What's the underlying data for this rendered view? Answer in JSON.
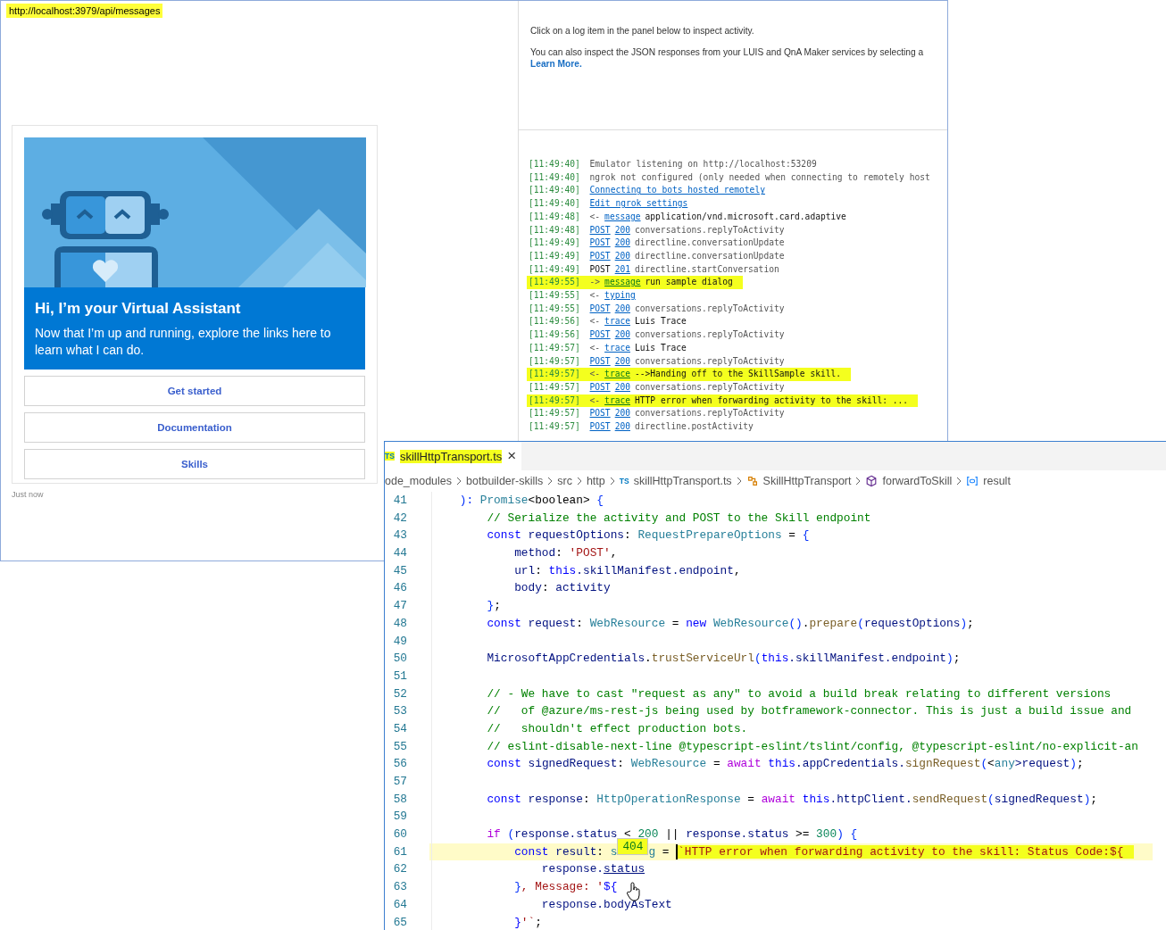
{
  "emulator": {
    "endpoint": "http://localhost:3979/api/messages",
    "card": {
      "heading": "Hi, I’m **your Virtual Assistant**",
      "body": "Now that I’m up and running, explore the links here to learn what I can do.",
      "buttons": [
        "Get started",
        "Documentation",
        "Skills"
      ]
    },
    "timestamp": "Just now",
    "inspector": {
      "hint": "Click on a log item in the panel below to inspect activity.",
      "info": "You can also inspect the JSON responses from your LUIS and QnA Maker services by selecting a",
      "link": "Learn More."
    },
    "log": [
      {
        "time": "[11:49:40]",
        "highlighted": false,
        "segments": [
          {
            "kind": "muted",
            "text": "Emulator listening on http://localhost:53209"
          }
        ]
      },
      {
        "time": "[11:49:40]",
        "highlighted": false,
        "segments": [
          {
            "kind": "muted",
            "text": "ngrok not configured (only needed when connecting to remotely host"
          }
        ]
      },
      {
        "time": "[11:49:40]",
        "highlighted": false,
        "segments": [
          {
            "kind": "link",
            "text": "Connecting to bots hosted remotely"
          }
        ]
      },
      {
        "time": "[11:49:40]",
        "highlighted": false,
        "segments": [
          {
            "kind": "link",
            "text": "Edit ngrok settings"
          }
        ]
      },
      {
        "time": "[11:49:48]",
        "highlighted": false,
        "segments": [
          {
            "kind": "muted",
            "text": "<-"
          },
          {
            "kind": "link",
            "text": "message"
          },
          {
            "kind": "text",
            "text": "application/vnd.microsoft.card.adaptive"
          }
        ]
      },
      {
        "time": "[11:49:48]",
        "highlighted": false,
        "segments": [
          {
            "kind": "link",
            "text": "POST"
          },
          {
            "kind": "link",
            "text": "200"
          },
          {
            "kind": "muted",
            "text": "conversations.replyToActivity"
          }
        ]
      },
      {
        "time": "[11:49:49]",
        "highlighted": false,
        "segments": [
          {
            "kind": "link",
            "text": "POST"
          },
          {
            "kind": "link",
            "text": "200"
          },
          {
            "kind": "muted",
            "text": "directline.conversationUpdate"
          }
        ]
      },
      {
        "time": "[11:49:49]",
        "highlighted": false,
        "segments": [
          {
            "kind": "link",
            "text": "POST"
          },
          {
            "kind": "link",
            "text": "200"
          },
          {
            "kind": "muted",
            "text": "directline.conversationUpdate"
          }
        ]
      },
      {
        "time": "[11:49:49]",
        "highlighted": false,
        "segments": [
          {
            "kind": "text",
            "text": "POST"
          },
          {
            "kind": "link",
            "text": "201"
          },
          {
            "kind": "muted",
            "text": "directline.startConversation"
          }
        ]
      },
      {
        "time": "[11:49:55]",
        "highlighted": true,
        "segments": [
          {
            "kind": "muted",
            "text": "->"
          },
          {
            "kind": "link",
            "text": "message"
          },
          {
            "kind": "text",
            "text": "run sample dialog"
          }
        ]
      },
      {
        "time": "[11:49:55]",
        "highlighted": false,
        "segments": [
          {
            "kind": "muted",
            "text": "<-"
          },
          {
            "kind": "link",
            "text": "typing"
          }
        ]
      },
      {
        "time": "[11:49:55]",
        "highlighted": false,
        "segments": [
          {
            "kind": "link",
            "text": "POST"
          },
          {
            "kind": "link",
            "text": "200"
          },
          {
            "kind": "muted",
            "text": "conversations.replyToActivity"
          }
        ]
      },
      {
        "time": "[11:49:56]",
        "highlighted": false,
        "segments": [
          {
            "kind": "muted",
            "text": "<-"
          },
          {
            "kind": "link",
            "text": "trace"
          },
          {
            "kind": "text",
            "text": "Luis Trace"
          }
        ]
      },
      {
        "time": "[11:49:56]",
        "highlighted": false,
        "segments": [
          {
            "kind": "link",
            "text": "POST"
          },
          {
            "kind": "link",
            "text": "200"
          },
          {
            "kind": "muted",
            "text": "conversations.replyToActivity"
          }
        ]
      },
      {
        "time": "[11:49:57]",
        "highlighted": false,
        "segments": [
          {
            "kind": "muted",
            "text": "<-"
          },
          {
            "kind": "link",
            "text": "trace"
          },
          {
            "kind": "text",
            "text": "Luis Trace"
          }
        ]
      },
      {
        "time": "[11:49:57]",
        "highlighted": false,
        "segments": [
          {
            "kind": "link",
            "text": "POST"
          },
          {
            "kind": "link",
            "text": "200"
          },
          {
            "kind": "muted",
            "text": "conversations.replyToActivity"
          }
        ]
      },
      {
        "time": "[11:49:57]",
        "highlighted": true,
        "segments": [
          {
            "kind": "muted",
            "text": "<-"
          },
          {
            "kind": "link",
            "text": "trace"
          },
          {
            "kind": "text",
            "text": "-->Handing off to the SkillSample skill."
          }
        ]
      },
      {
        "time": "[11:49:57]",
        "highlighted": false,
        "segments": [
          {
            "kind": "link",
            "text": "POST"
          },
          {
            "kind": "link",
            "text": "200"
          },
          {
            "kind": "muted",
            "text": "conversations.replyToActivity"
          }
        ]
      },
      {
        "time": "[11:49:57]",
        "highlighted": true,
        "segments": [
          {
            "kind": "muted",
            "text": "<-"
          },
          {
            "kind": "link",
            "text": "trace"
          },
          {
            "kind": "text",
            "text": "HTTP error when forwarding activity to the skill: ..."
          }
        ]
      },
      {
        "time": "[11:49:57]",
        "highlighted": false,
        "segments": [
          {
            "kind": "link",
            "text": "POST"
          },
          {
            "kind": "link",
            "text": "200"
          },
          {
            "kind": "muted",
            "text": "conversations.replyToActivity"
          }
        ]
      },
      {
        "time": "[11:49:57]",
        "highlighted": false,
        "segments": [
          {
            "kind": "link",
            "text": "POST"
          },
          {
            "kind": "link",
            "text": "200"
          },
          {
            "kind": "muted",
            "text": "directline.postActivity"
          }
        ]
      }
    ]
  },
  "editor": {
    "tab": {
      "badge": "TS",
      "label": "skillHttpTransport.ts",
      "close": "×",
      "selected": true,
      "highlighted": true
    },
    "breadcrumbs": [
      {
        "kind": "folder",
        "text": "ode_modules"
      },
      {
        "kind": "folder",
        "text": "botbuilder-skills"
      },
      {
        "kind": "folder",
        "text": "src"
      },
      {
        "kind": "folder",
        "text": "http"
      },
      {
        "kind": "file",
        "badge": "TS",
        "text": "skillHttpTransport.ts"
      },
      {
        "kind": "class",
        "text": "SkillHttpTransport"
      },
      {
        "kind": "method",
        "text": "forwardToSkill"
      },
      {
        "kind": "variable",
        "text": "result"
      }
    ],
    "lines": [
      {
        "number": "41",
        "current": false,
        "tokens": [
          {
            "kind": "brace",
            "text": "    ): "
          },
          {
            "kind": "type",
            "text": "Promise"
          },
          {
            "kind": "plain",
            "text": "<boolean> "
          },
          {
            "kind": "brace",
            "text": "{"
          }
        ]
      },
      {
        "number": "42",
        "current": false,
        "tokens": [
          {
            "kind": "comment",
            "text": "        // Serialize the activity and POST to the Skill endpoint"
          }
        ]
      },
      {
        "number": "43",
        "current": false,
        "tokens": [
          {
            "kind": "keyword",
            "text": "        const"
          },
          {
            "kind": "variable",
            "text": " requestOptions"
          },
          {
            "kind": "plain",
            "text": ": "
          },
          {
            "kind": "type",
            "text": "RequestPrepareOptions"
          },
          {
            "kind": "plain",
            "text": " = "
          },
          {
            "kind": "brace",
            "text": "{"
          }
        ]
      },
      {
        "number": "44",
        "current": false,
        "tokens": [
          {
            "kind": "variable",
            "text": "            method"
          },
          {
            "kind": "plain",
            "text": ": "
          },
          {
            "kind": "string",
            "text": "'POST'"
          },
          {
            "kind": "plain",
            "text": ","
          }
        ]
      },
      {
        "number": "45",
        "current": false,
        "tokens": [
          {
            "kind": "variable",
            "text": "            url"
          },
          {
            "kind": "plain",
            "text": ": "
          },
          {
            "kind": "keyword",
            "text": "this"
          },
          {
            "kind": "variable",
            "text": ".skillManifest.endpoint"
          },
          {
            "kind": "plain",
            "text": ","
          }
        ]
      },
      {
        "number": "46",
        "current": false,
        "tokens": [
          {
            "kind": "variable",
            "text": "            body"
          },
          {
            "kind": "plain",
            "text": ": "
          },
          {
            "kind": "variable",
            "text": "activity"
          }
        ]
      },
      {
        "number": "47",
        "current": false,
        "tokens": [
          {
            "kind": "brace",
            "text": "        }"
          },
          {
            "kind": "plain",
            "text": ";"
          }
        ]
      },
      {
        "number": "48",
        "current": false,
        "tokens": [
          {
            "kind": "keyword",
            "text": "        const"
          },
          {
            "kind": "variable",
            "text": " request"
          },
          {
            "kind": "plain",
            "text": ": "
          },
          {
            "kind": "type",
            "text": "WebResource"
          },
          {
            "kind": "plain",
            "text": " = "
          },
          {
            "kind": "keyword",
            "text": "new"
          },
          {
            "kind": "type",
            "text": " WebResource"
          },
          {
            "kind": "brace",
            "text": "()"
          },
          {
            "kind": "plain",
            "text": "."
          },
          {
            "kind": "function",
            "text": "prepare"
          },
          {
            "kind": "brace",
            "text": "("
          },
          {
            "kind": "variable",
            "text": "requestOptions"
          },
          {
            "kind": "brace",
            "text": ")"
          },
          {
            "kind": "plain",
            "text": ";"
          }
        ]
      },
      {
        "number": "49",
        "current": false
      },
      {
        "number": "50",
        "current": false,
        "tokens": [
          {
            "kind": "variable",
            "text": "        MicrosoftAppCredentials"
          },
          {
            "kind": "plain",
            "text": "."
          },
          {
            "kind": "function",
            "text": "trustServiceUrl"
          },
          {
            "kind": "brace",
            "text": "("
          },
          {
            "kind": "keyword",
            "text": "this"
          },
          {
            "kind": "variable",
            "text": ".skillManifest.endpoint"
          },
          {
            "kind": "brace",
            "text": ")"
          },
          {
            "kind": "plain",
            "text": ";"
          }
        ]
      },
      {
        "number": "51",
        "current": false
      },
      {
        "number": "52",
        "current": false,
        "tokens": [
          {
            "kind": "comment",
            "text": "        // - We have to cast \"request as any\" to avoid a build break relating to different versions"
          }
        ]
      },
      {
        "number": "53",
        "current": false,
        "tokens": [
          {
            "kind": "comment",
            "text": "        //   of @azure/ms-rest-js being used by botframework-connector. This is just a build issue and"
          }
        ]
      },
      {
        "number": "54",
        "current": false,
        "tokens": [
          {
            "kind": "comment",
            "text": "        //   shouldn't effect production bots."
          }
        ]
      },
      {
        "number": "55",
        "current": false,
        "tokens": [
          {
            "kind": "comment",
            "text": "        // eslint-disable-next-line @typescript-eslint/tslint/config, @typescript-eslint/no-explicit-an"
          }
        ]
      },
      {
        "number": "56",
        "current": false,
        "tokens": [
          {
            "kind": "keyword",
            "text": "        const"
          },
          {
            "kind": "variable",
            "text": " signedRequest"
          },
          {
            "kind": "plain",
            "text": ": "
          },
          {
            "kind": "type",
            "text": "WebResource"
          },
          {
            "kind": "plain",
            "text": " = "
          },
          {
            "kind": "control",
            "text": "await"
          },
          {
            "kind": "keyword",
            "text": " this"
          },
          {
            "kind": "variable",
            "text": ".appCredentials."
          },
          {
            "kind": "function",
            "text": "signRequest"
          },
          {
            "kind": "brace",
            "text": "("
          },
          {
            "kind": "plain",
            "text": "<"
          },
          {
            "kind": "type",
            "text": "any"
          },
          {
            "kind": "variable",
            "text": ">request"
          },
          {
            "kind": "brace",
            "text": ")"
          },
          {
            "kind": "plain",
            "text": ";"
          }
        ]
      },
      {
        "number": "57",
        "current": false
      },
      {
        "number": "58",
        "current": false,
        "tokens": [
          {
            "kind": "keyword",
            "text": "        const"
          },
          {
            "kind": "variable",
            "text": " response"
          },
          {
            "kind": "plain",
            "text": ": "
          },
          {
            "kind": "type",
            "text": "HttpOperationResponse"
          },
          {
            "kind": "plain",
            "text": " = "
          },
          {
            "kind": "control",
            "text": "await"
          },
          {
            "kind": "keyword",
            "text": " this"
          },
          {
            "kind": "variable",
            "text": ".httpClient."
          },
          {
            "kind": "function",
            "text": "sendRequest"
          },
          {
            "kind": "brace",
            "text": "("
          },
          {
            "kind": "variable",
            "text": "signedRequest"
          },
          {
            "kind": "brace",
            "text": ")"
          },
          {
            "kind": "plain",
            "text": ";"
          }
        ]
      },
      {
        "number": "59",
        "current": false
      },
      {
        "number": "60",
        "current": false,
        "tokens": [
          {
            "kind": "control",
            "text": "        if"
          },
          {
            "kind": "brace",
            "text": " ("
          },
          {
            "kind": "variable",
            "text": "response.status"
          },
          {
            "kind": "plain",
            "text": " < "
          },
          {
            "kind": "number",
            "text": "200"
          },
          {
            "kind": "plain",
            "text": " || "
          },
          {
            "kind": "variable",
            "text": "response.status"
          },
          {
            "kind": "plain",
            "text": " >= "
          },
          {
            "kind": "number",
            "text": "300"
          },
          {
            "kind": "brace",
            "text": ") {"
          }
        ]
      },
      {
        "number": "61",
        "current": true,
        "tokens": [
          {
            "kind": "keyword",
            "text": "            const"
          },
          {
            "kind": "variable",
            "text": " result"
          },
          {
            "kind": "plain",
            "text": ": "
          },
          {
            "kind": "type",
            "text": "s"
          },
          {
            "kind": "hover",
            "text": "404"
          },
          {
            "kind": "type",
            "text": "g"
          },
          {
            "kind": "plain",
            "text": " = "
          },
          {
            "kind": "caret"
          },
          {
            "kind": "marked",
            "text": "`HTTP error when forwarding activity to the skill: Status Code:${"
          }
        ]
      },
      {
        "number": "62",
        "current": false,
        "tokens": [
          {
            "kind": "variable",
            "text": "                response."
          },
          {
            "kind": "hovered",
            "text": "status"
          }
        ]
      },
      {
        "number": "63",
        "current": false,
        "tokens": [
          {
            "kind": "brace",
            "text": "            }"
          },
          {
            "kind": "string",
            "text": ", Message: '"
          },
          {
            "kind": "keyword",
            "text": "${"
          }
        ]
      },
      {
        "number": "64",
        "current": false,
        "tokens": [
          {
            "kind": "variable",
            "text": "                response.bodyAsText"
          }
        ]
      },
      {
        "number": "65",
        "current": false,
        "tokens": [
          {
            "kind": "keyword",
            "text": "            }"
          },
          {
            "kind": "string",
            "text": "'`"
          },
          {
            "kind": "plain",
            "text": ";"
          }
        ]
      }
    ]
  }
}
